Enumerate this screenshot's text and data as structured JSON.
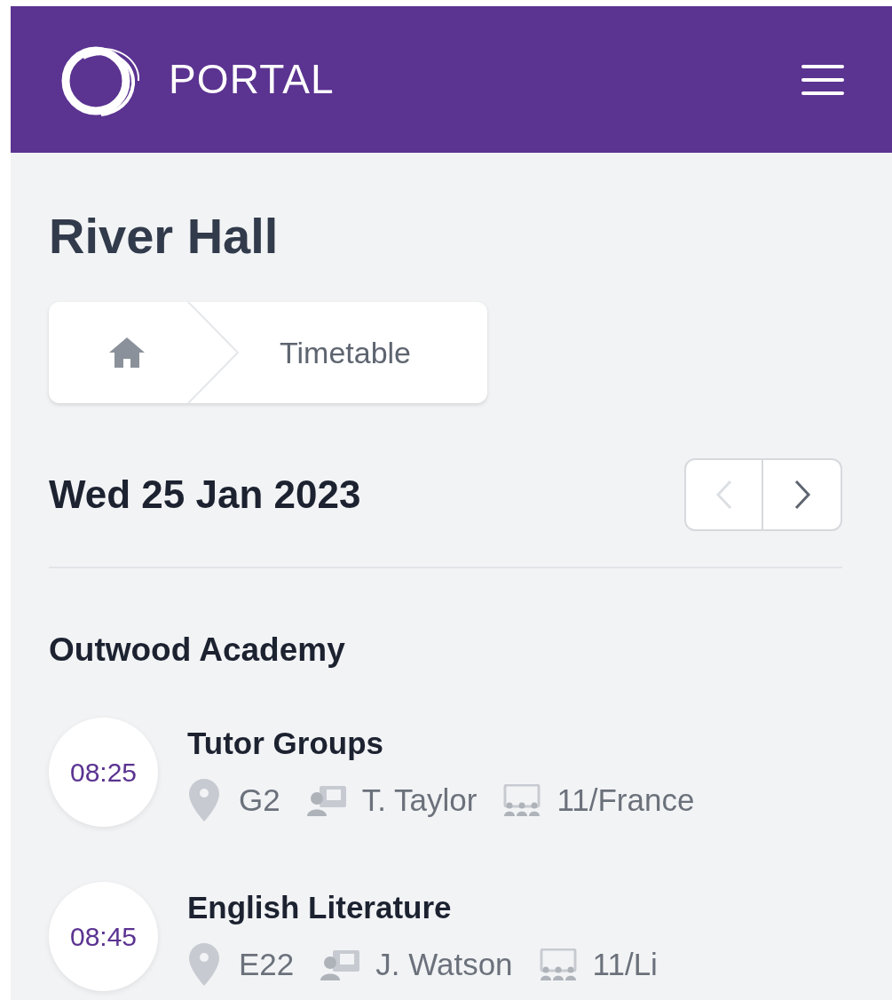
{
  "header": {
    "brand": "PORTAL"
  },
  "page_title": "River Hall",
  "breadcrumb": {
    "current": "Timetable"
  },
  "date_nav": {
    "date": "Wed 25 Jan 2023",
    "prev_disabled": true,
    "next_disabled": false
  },
  "school": "Outwood Academy",
  "lessons": [
    {
      "time": "08:25",
      "title": "Tutor Groups",
      "room": "G2",
      "teacher": "T. Taylor",
      "group": "11/France"
    },
    {
      "time": "08:45",
      "title": "English Literature",
      "room": "E22",
      "teacher": "J. Watson",
      "group": "11/Li"
    }
  ]
}
